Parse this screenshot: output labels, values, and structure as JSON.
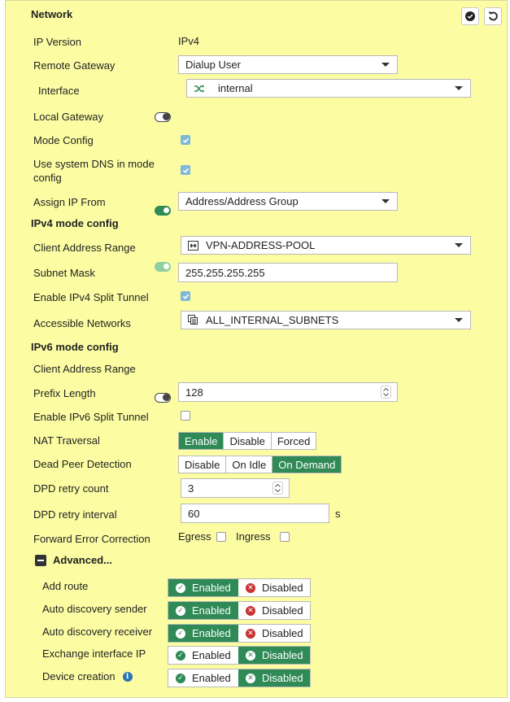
{
  "section_title": "Network",
  "header_buttons": [
    {
      "icon": "check-circle-icon"
    },
    {
      "icon": "undo-icon"
    }
  ],
  "fields": {
    "ip_version": {
      "label": "IP Version",
      "value": "IPv4"
    },
    "remote_gateway": {
      "label": "Remote Gateway",
      "value": "Dialup User"
    },
    "interface": {
      "label": "Interface",
      "value": "internal",
      "icon": "shuffle-icon"
    },
    "local_gateway": {
      "label": "Local Gateway",
      "state": "off"
    },
    "mode_config": {
      "label": "Mode Config",
      "checked": true
    },
    "use_system_dns": {
      "label": "Use system DNS in mode config",
      "line1": "Use system DNS in mode",
      "line2": "config",
      "checked": true
    },
    "assign_ip_from": {
      "label": "Assign IP From",
      "state": "on",
      "value": "Address/Address Group"
    }
  },
  "ipv4": {
    "title": "IPv4 mode config",
    "client_address_range": {
      "label": "Client Address Range",
      "state": "on-dimmed",
      "value": "VPN-ADDRESS-POOL",
      "icon": "address-range-icon"
    },
    "subnet_mask": {
      "label": "Subnet Mask",
      "value": "255.255.255.255"
    },
    "split_tunnel": {
      "label": "Enable IPv4 Split Tunnel",
      "checked": true
    },
    "accessible_networks": {
      "label": "Accessible Networks",
      "value": "ALL_INTERNAL_SUBNETS",
      "icon": "address-group-icon"
    }
  },
  "ipv6": {
    "title": "IPv6 mode config",
    "client_address_range": {
      "label": "Client Address Range",
      "state": "off"
    },
    "prefix_length": {
      "label": "Prefix Length",
      "value": "128"
    },
    "split_tunnel": {
      "label": "Enable IPv6 Split Tunnel",
      "checked": false
    }
  },
  "nat_traversal": {
    "label": "NAT Traversal",
    "options": [
      "Enable",
      "Disable",
      "Forced"
    ],
    "selected": "Enable"
  },
  "dead_peer_detection": {
    "label": "Dead Peer Detection",
    "options": [
      "Disable",
      "On Idle",
      "On Demand"
    ],
    "selected": "On Demand"
  },
  "dpd_retry_count": {
    "label": "DPD retry count",
    "value": "3"
  },
  "dpd_retry_interval": {
    "label": "DPD retry interval",
    "value": "60",
    "unit": "s"
  },
  "fec": {
    "label": "Forward Error Correction",
    "egress_label": "Egress",
    "egress_checked": false,
    "ingress_label": "Ingress",
    "ingress_checked": false
  },
  "advanced": {
    "label": "Advanced...",
    "expanded": true,
    "enabled_label": "Enabled",
    "disabled_label": "Disabled",
    "rows": [
      {
        "label": "Add route",
        "selected": "Enabled"
      },
      {
        "label": "Auto discovery sender",
        "selected": "Enabled"
      },
      {
        "label": "Auto discovery receiver",
        "selected": "Enabled"
      },
      {
        "label": "Exchange interface IP",
        "selected": "Disabled"
      },
      {
        "label": "Device creation",
        "selected": "Disabled",
        "info_icon": "info-icon"
      }
    ]
  },
  "colors": {
    "panel_bg": "#fcfda3",
    "active_green": "#2f8a56",
    "error_red": "#c83232",
    "checkbox_blue": "#7fb8d8"
  }
}
